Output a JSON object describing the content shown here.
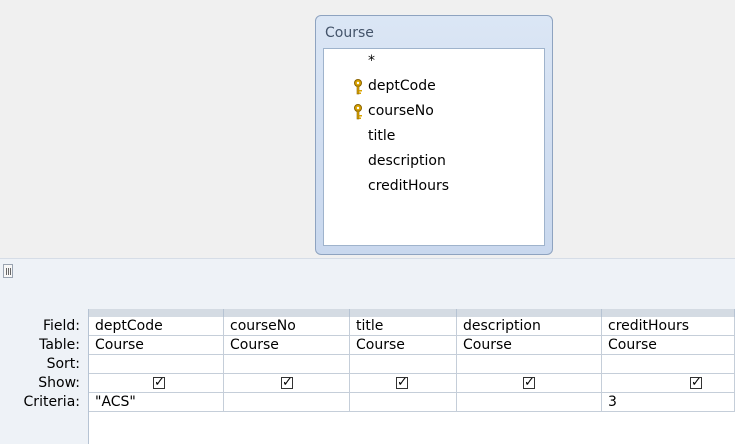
{
  "query_design": {
    "table": {
      "title": "Course",
      "fields": [
        {
          "label": "*",
          "key": false
        },
        {
          "label": "deptCode",
          "key": true
        },
        {
          "label": "courseNo",
          "key": true
        },
        {
          "label": "title",
          "key": false
        },
        {
          "label": "description",
          "key": false
        },
        {
          "label": "creditHours",
          "key": false
        }
      ]
    },
    "row_labels": {
      "field": "Field:",
      "table": "Table:",
      "sort": "Sort:",
      "show": "Show:",
      "criteria": "Criteria:"
    },
    "columns": [
      {
        "field": "deptCode",
        "table": "Course",
        "sort": "",
        "show": true,
        "criteria": "\"ACS\""
      },
      {
        "field": "courseNo",
        "table": "Course",
        "sort": "",
        "show": true,
        "criteria": ""
      },
      {
        "field": "title",
        "table": "Course",
        "sort": "",
        "show": true,
        "criteria": ""
      },
      {
        "field": "description",
        "table": "Course",
        "sort": "",
        "show": true,
        "criteria": ""
      },
      {
        "field": "creditHours",
        "table": "Course",
        "sort": "",
        "show": true,
        "criteria": "3"
      }
    ]
  }
}
